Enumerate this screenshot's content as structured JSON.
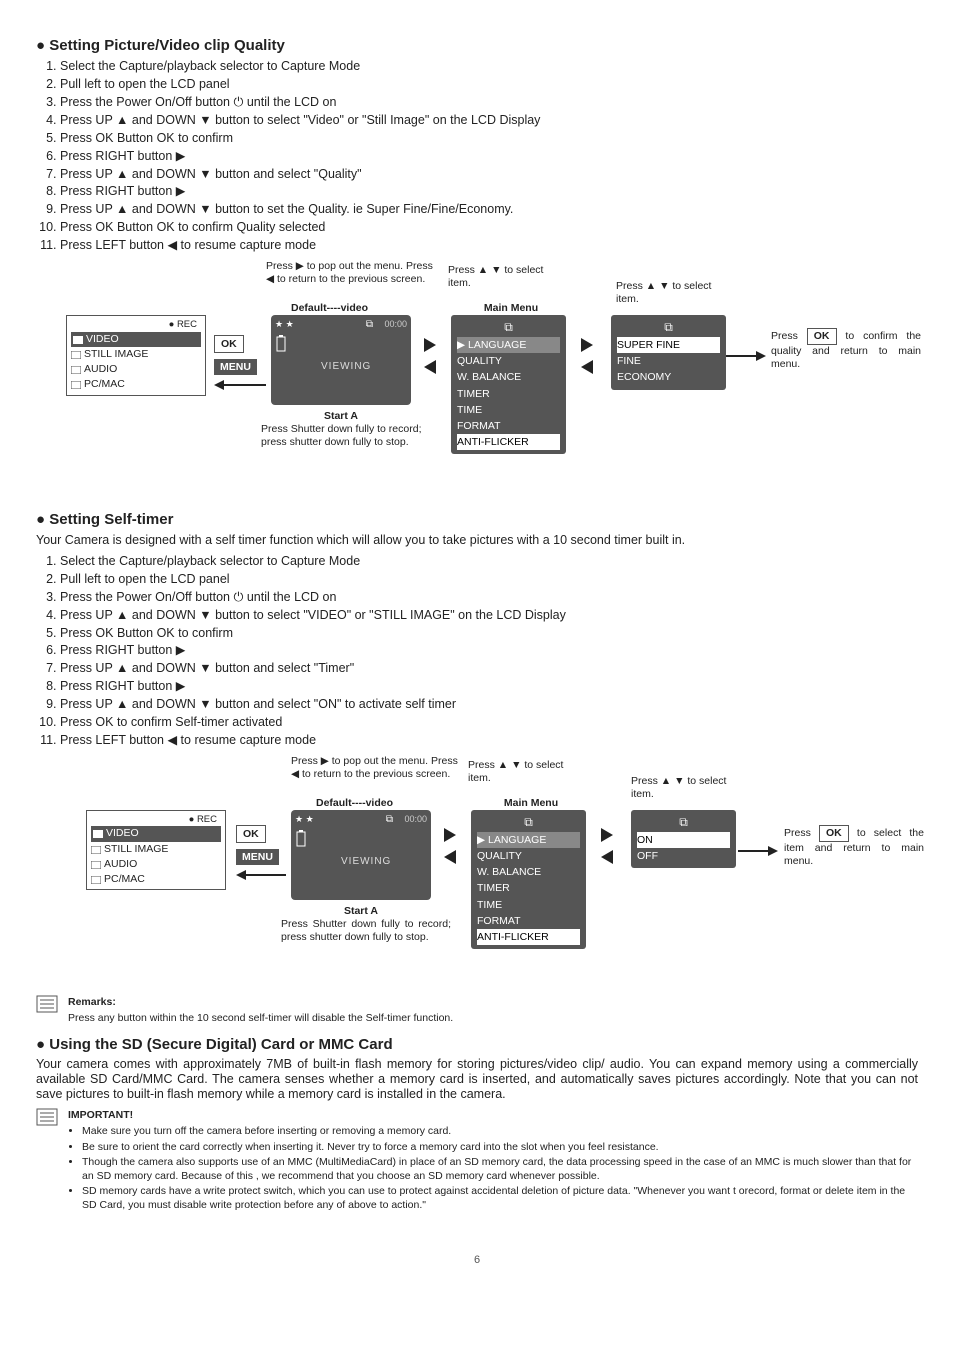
{
  "page_number": "6",
  "icons": {
    "tri_up": "▲",
    "tri_down": "▼",
    "tri_left": "◀",
    "tri_right": "▶",
    "power": "⏻",
    "rec_dot": "●"
  },
  "section1": {
    "title": "Setting Picture/Video clip Quality",
    "steps": [
      "Select the Capture/playback selector to Capture Mode",
      "Pull left to open the LCD panel",
      "Press the Power On/Off button ⏻ until the LCD on",
      "Press UP ▲ and DOWN ▼ button to select \"Video\" or \"Still Image\" on the LCD Display",
      "Press OK Button OK to confirm",
      "Press RIGHT button ▶",
      "Press UP ▲ and DOWN ▼ button and select \"Quality\"",
      "Press RIGHT button ▶",
      "Press UP ▲ and DOWN ▼ button to set the Quality. ie Super Fine/Fine/Economy.",
      "Press OK Button OK to confirm Quality selected",
      "Press LEFT button ◀ to resume capture mode"
    ]
  },
  "section2": {
    "title": "Setting Self-timer",
    "intro": "Your Camera is designed with a self timer function which will allow you to take pictures with a 10 second timer built in.",
    "steps": [
      "Select the Capture/playback selector to Capture Mode",
      "Pull left to open the LCD panel",
      "Press the Power On/Off button ⏻ until the LCD on",
      "Press UP ▲ and DOWN ▼ button to select \"VIDEO\" or \"STILL IMAGE\" on the LCD Display",
      "Press OK Button OK to confirm",
      "Press RIGHT button ▶",
      "Press UP ▲ and DOWN ▼ button and select \"Timer\"",
      "Press RIGHT button ▶",
      "Press UP ▲ and DOWN ▼ button and select \"ON\" to activate self timer",
      "Press OK to confirm Self-timer activated",
      "Press LEFT button ◀ to resume capture mode"
    ],
    "remark_label": "Remarks:",
    "remark_body": "Press any button within the 10 second self-timer will disable the Self-timer function."
  },
  "section3": {
    "title": "Using the SD (Secure Digital) Card or MMC Card",
    "intro": "Your camera comes with approximately 7MB of built-in flash memory for storing pictures/video clip/ audio. You can expand memory using a commercially available SD Card/MMC Card. The camera senses whether a memory card is inserted, and automatically saves pictures accordingly. Note that you can not save pictures to built-in flash memory while a memory card is installed in the camera.",
    "important_label": "IMPORTANT!",
    "bullets": [
      "Make sure you turn off the camera before inserting or removing a memory card.",
      "Be sure to orient the card correctly when inserting it. Never try to force a memory card into the slot when you feel resistance.",
      "Though the camera also supports use of an MMC (MultiMediaCard) in place of an SD memory card, the data processing speed in the case of an MMC is much slower than that for an SD memory card. Because of this , we recommend that you choose an SD memory card whenever possible.",
      "SD memory cards have a write protect switch, which you can use to protect against accidental deletion of picture data. \"Whenever you want t orecord, format or delete item in the SD Card, you must disable write protection before any of above to action.\""
    ]
  },
  "diagram": {
    "cap_lines": "Press ▶ to pop out the menu.\nPress ◀ to return to the previous screen.",
    "default_video": "Default----video",
    "start_a": "Start A",
    "shutter_note": "Press Shutter down fully to record; press shutter down fully to stop.",
    "select_item": "Press ▲ ▼ to select item.",
    "main_menu_title": "Main Menu",
    "ok_label": "OK",
    "menu_label": "MENU",
    "lcd": {
      "stars": "★ ★",
      "time": "00:00",
      "view": "VIEWING"
    },
    "modebox": {
      "rec": "● REC",
      "items": [
        "VIDEO",
        "STILL IMAGE",
        "AUDIO",
        "PC/MAC"
      ]
    },
    "main_menu_items": [
      "LANGUAGE",
      "QUALITY",
      "W. BALANCE",
      "TIMER",
      "TIME",
      "FORMAT",
      "ANTI-FLICKER"
    ],
    "quality_items": [
      "SUPER FINE",
      "FINE",
      "ECONOMY"
    ],
    "quality_note": "Press OK to confirm the quality and return to main menu.",
    "timer_items": [
      "ON",
      "OFF"
    ],
    "timer_note": "Press OK to select the item and return to main menu."
  }
}
